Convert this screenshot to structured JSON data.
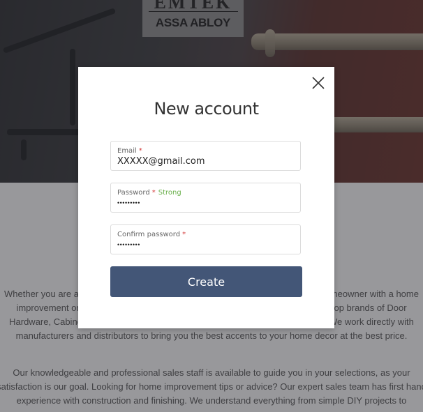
{
  "brand": {
    "logo_top": "EMTEK",
    "logo_bottom": "ASSA ABLOY"
  },
  "background_text": {
    "paragraph1": "Whether you are a professional builder, designer or architect, a craftsman or a homeowner with a home improvement or renovation project, we offer you the widest selection of quality top brands of Door Hardware, Cabinet Hardware, Bath Hardware and Lighting at affordable prices. We work directly with manufacturers and distributors to bring you the best accents to your home decor at the best price.",
    "paragraph2": "Our knowledgeable and professional sales staff is available to guide you in your selections, as your satisfaction is our goal. Looking for home improvement tips or advice? Our expert sales team has first hand experience with construction and finishing. We understand everything from simple DIY projects to"
  },
  "modal": {
    "title": "New account",
    "close_icon": "close-icon",
    "email": {
      "label": "Email",
      "required_mark": "*",
      "value": "XXXXX@gmail.com"
    },
    "password": {
      "label": "Password",
      "required_mark": "*",
      "strength": "Strong",
      "value": "•••••••••"
    },
    "confirm_password": {
      "label": "Confirm password",
      "required_mark": "*",
      "value": "•••••••••"
    },
    "create_label": "Create"
  },
  "colors": {
    "primary_button": "#435677",
    "required": "#d43c3c",
    "strength_strong": "#6ab04c"
  }
}
